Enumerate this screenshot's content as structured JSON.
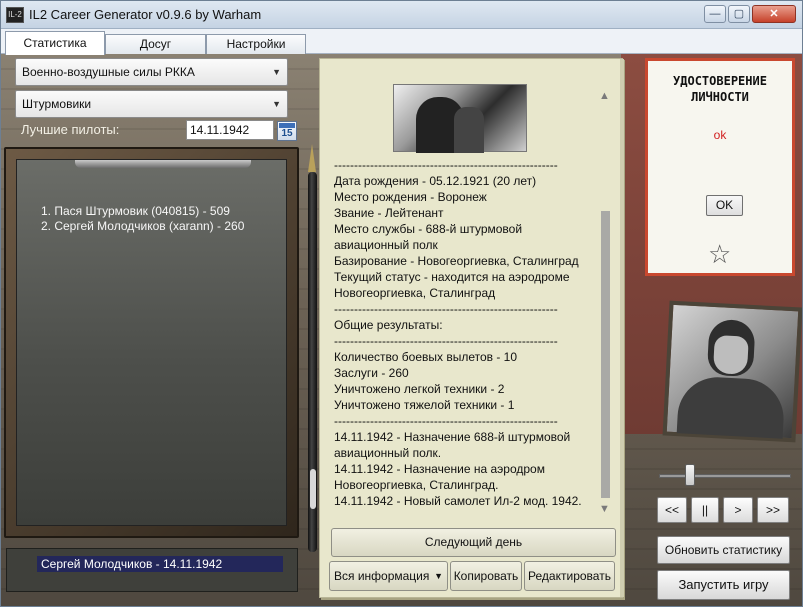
{
  "window": {
    "title": "IL2 Career Generator v0.9.6 by Warham",
    "app_icon_label": "IL-2",
    "controls": {
      "minimize": "—",
      "maximize": "▢",
      "close": "✕"
    }
  },
  "tabs": [
    {
      "label": "Статистика",
      "active": true
    },
    {
      "label": "Досуг",
      "active": false
    },
    {
      "label": "Настройки",
      "active": false
    }
  ],
  "filters": {
    "air_force": "Военно-воздушные силы РККА",
    "unit_type": "Штурмовики"
  },
  "best_pilots": {
    "label": "Лучшие пилоты:",
    "date": "14.11.1942",
    "calendar_day": "15",
    "list": [
      "1. Пася Штурмовик (040815) - 509",
      "2. Сергей Молодчиков (xarann) - 260"
    ]
  },
  "selected_pilot": "Сергей Молодчиков - 14.11.1942",
  "record": {
    "lines": [
      "--------------------------------------------------------",
      "Дата рождения - 05.12.1921 (20 лет)",
      "Место рождения - Воронеж",
      "Звание - Лейтенант",
      "Место службы - 688-й штурмовой",
      "авиационный полк",
      "Базирование - Новогеоргиевка, Сталинград",
      "Текущий статус - находится на аэродроме",
      "Новогеоргиевка, Сталинград",
      "--------------------------------------------------------",
      "Общие результаты:",
      "--------------------------------------------------------",
      "Количество боевых вылетов - 10",
      "Заслуги - 260",
      "Уничтожено легкой техники - 2",
      "Уничтожено тяжелой техники - 1",
      "--------------------------------------------------------",
      "14.11.1942 - Назначение 688-й штурмовой",
      "авиационный полк.",
      "14.11.1942 - Назначение на аэродром",
      "Новогеоргиевка, Сталинград.",
      "14.11.1942 - Новый самолет Ил-2 мод. 1942."
    ]
  },
  "notebook_actions": {
    "next_day": "Следующий день",
    "info_mode": "Вся информация",
    "copy": "Копировать",
    "edit": "Редактировать"
  },
  "id_card": {
    "title": "УДОСТОВЕРЕНИЕ ЛИЧНОСТИ",
    "status": "ok",
    "ok_button": "OK"
  },
  "playback": {
    "prev": "<<",
    "pause": "||",
    "next": ">",
    "fast_forward": ">>"
  },
  "actions": {
    "refresh_stats": "Обновить статистику",
    "launch_game": "Запустить игру"
  },
  "colors": {
    "accent_red": "#c9482f",
    "selection": "#23275a",
    "status_ok": "#d11f1f"
  }
}
